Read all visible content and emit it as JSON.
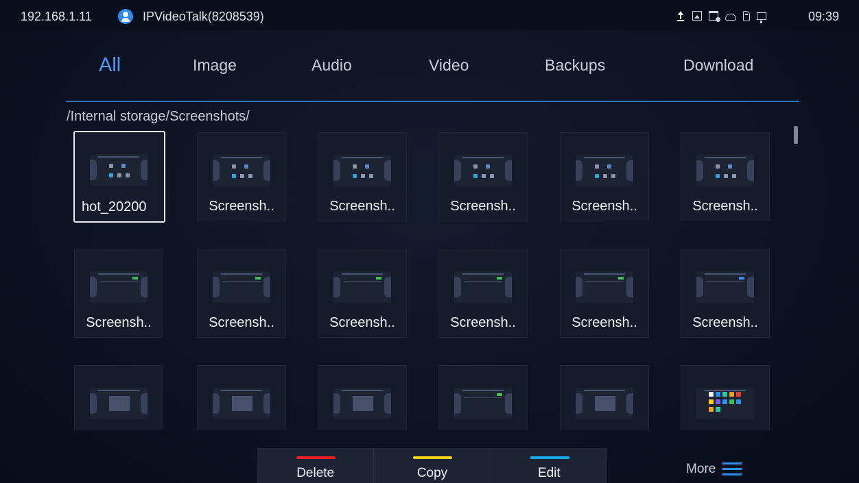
{
  "status_bar": {
    "ip": "192.168.1.11",
    "account": "IPVideoTalk(8208539)",
    "time": "09:39",
    "icons": [
      "upload-icon",
      "image-icon",
      "calendar-icon",
      "cloud-icon",
      "sd-card-icon",
      "monitor-icon"
    ]
  },
  "tabs": [
    {
      "label": "All",
      "active": true
    },
    {
      "label": "Image",
      "active": false
    },
    {
      "label": "Audio",
      "active": false
    },
    {
      "label": "Video",
      "active": false
    },
    {
      "label": "Backups",
      "active": false
    },
    {
      "label": "Download",
      "active": false
    }
  ],
  "path": "/Internal storage/Screenshots/",
  "files": [
    {
      "name": "hot_20200",
      "selected": true
    },
    {
      "name": "Screensh.."
    },
    {
      "name": "Screensh.."
    },
    {
      "name": "Screensh.."
    },
    {
      "name": "Screensh.."
    },
    {
      "name": "Screensh.."
    },
    {
      "name": "Screensh.."
    },
    {
      "name": "Screensh.."
    },
    {
      "name": "Screensh.."
    },
    {
      "name": "Screensh.."
    },
    {
      "name": "Screensh.."
    },
    {
      "name": "Screensh.."
    },
    {
      "name": ""
    },
    {
      "name": ""
    },
    {
      "name": ""
    },
    {
      "name": ""
    },
    {
      "name": ""
    },
    {
      "name": ""
    }
  ],
  "toolbar": {
    "buttons": [
      {
        "label": "Delete",
        "color": "#e8202a"
      },
      {
        "label": "Copy",
        "color": "#f4d119"
      },
      {
        "label": "Edit",
        "color": "#19a8e8"
      }
    ],
    "more_label": "More"
  },
  "colors": {
    "accent": "#4a9bf5",
    "background": "#0c1222"
  }
}
